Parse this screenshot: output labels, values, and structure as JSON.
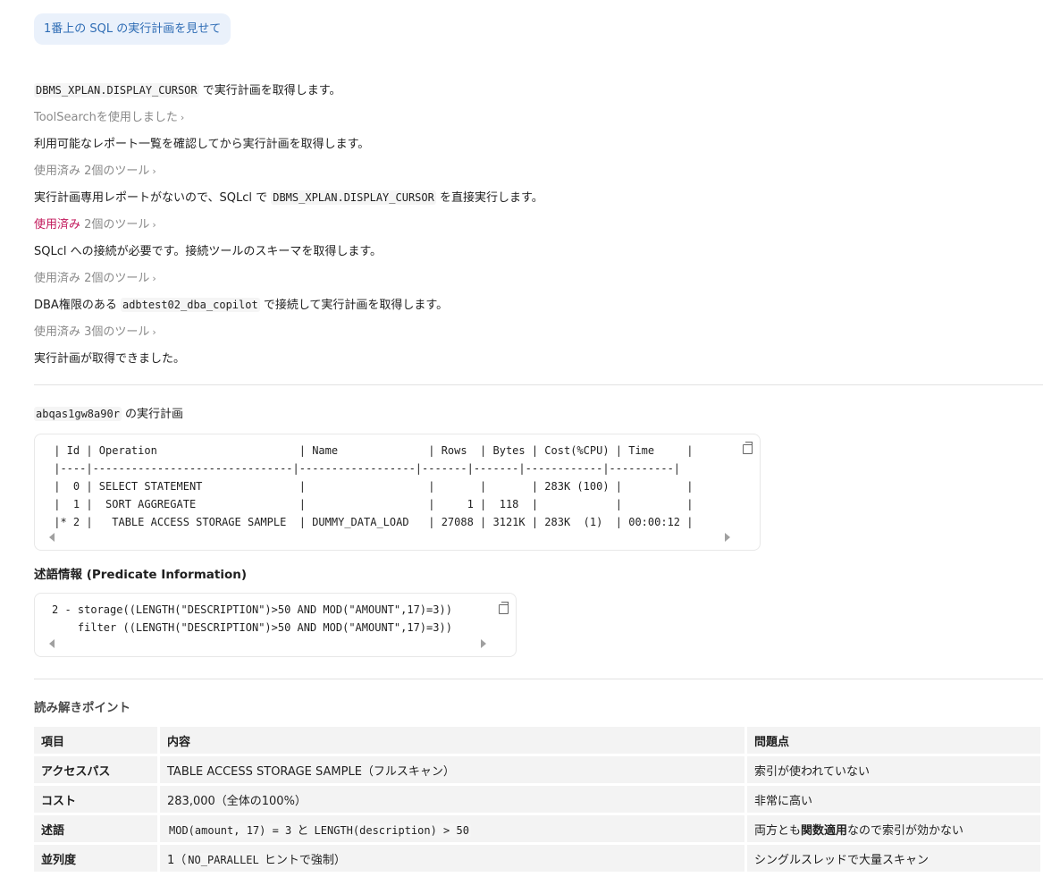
{
  "user_message": "1番上の SQL の実行計画を見せて",
  "messages": {
    "line1_code": "DBMS_XPLAN.DISPLAY_CURSOR",
    "line1_text": " で実行計画を取得します。",
    "tool1": "ToolSearchを使用しました",
    "line2": "利用可能なレポート一覧を確認してから実行計画を取得します。",
    "tool2": "使用済み 2個のツール",
    "line3_pre": "実行計画専用レポートがないので、SQLcl で ",
    "line3_code": "DBMS_XPLAN.DISPLAY_CURSOR",
    "line3_post": " を直接実行します。",
    "tool3_hl": "使用済み",
    "tool3_rest": " 2個のツール",
    "line4": "SQLcl への接続が必要です。接続ツールのスキーマを取得します。",
    "tool4": "使用済み 2個のツール",
    "line5_pre": "DBA権限のある ",
    "line5_code": "adbtest02_dba_copilot",
    "line5_post": " で接続して実行計画を取得します。",
    "tool5": "使用済み 3個のツール",
    "line6": "実行計画が取得できました。"
  },
  "plan_heading_code": "abqas1gw8a90r",
  "plan_heading_text": " の実行計画",
  "plan_code": " | Id | Operation                      | Name              | Rows  | Bytes | Cost(%CPU) | Time     |\n |----|-------------------------------|------------------|-------|-------|------------|----------|\n |  0 | SELECT STATEMENT               |                   |       |       | 283K (100) |          |\n |  1 |  SORT AGGREGATE                |                   |     1 |  118  |            |          |\n |* 2 |   TABLE ACCESS STORAGE SAMPLE  | DUMMY_DATA_LOAD   | 27088 | 3121K | 283K  (1)  | 00:00:12 |",
  "predicate_title": "述語情報 (Predicate Information)",
  "predicate_code": "2 - storage((LENGTH(\"DESCRIPTION\")>50 AND MOD(\"AMOUNT\",17)=3))\n    filter ((LENGTH(\"DESCRIPTION\")>50 AND MOD(\"AMOUNT\",17)=3))",
  "points_title": "読み解きポイント",
  "table": {
    "headers": [
      "項目",
      "内容",
      "問題点"
    ],
    "rows": [
      {
        "key": "アクセスパス",
        "content": "TABLE ACCESS STORAGE SAMPLE（フルスキャン）",
        "issue": "索引が使われていない"
      },
      {
        "key": "コスト",
        "content": "283,000（全体の100%）",
        "issue": "非常に高い"
      },
      {
        "key": "述語",
        "content_code1": "MOD(amount, 17) = 3",
        "content_mid": " と ",
        "content_code2": "LENGTH(description) > 50",
        "issue_pre": "両方とも",
        "issue_bold": "関数適用",
        "issue_post": "なので索引が効かない"
      },
      {
        "key": "並列度",
        "content_pre": "1（",
        "content_code": "NO_PARALLEL",
        "content_post": " ヒントで強制）",
        "issue": "シングルスレッドで大量スキャン"
      }
    ]
  }
}
